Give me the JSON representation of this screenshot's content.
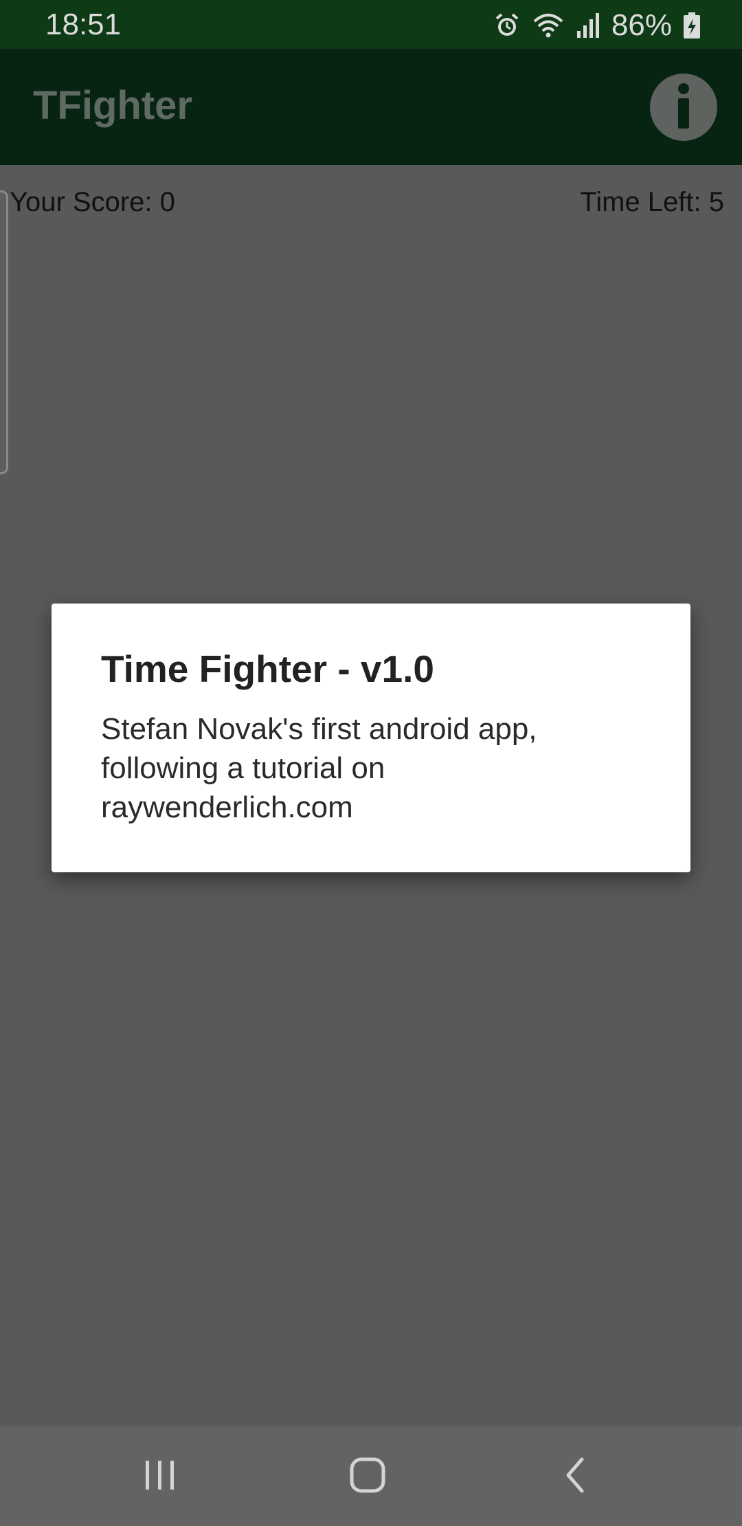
{
  "status_bar": {
    "time": "18:51",
    "battery_percent": "86%",
    "icons": [
      "alarm-icon",
      "wifi-icon",
      "signal-icon",
      "battery-charging-icon"
    ]
  },
  "app_bar": {
    "title": "TFighter",
    "info_icon": "info-icon"
  },
  "game": {
    "score_text": "Your Score: 0",
    "time_left_text": "Time Left: 5"
  },
  "dialog": {
    "title": "Time Fighter - v1.0",
    "message": "Stefan Novak's first android app, following a tutorial on raywenderlich.com"
  },
  "nav_bar": {
    "icons": [
      "recents-icon",
      "home-icon",
      "back-icon"
    ]
  },
  "colors": {
    "status_bar": "#0e3a16",
    "app_bar": "#072413",
    "scrim_background": "#595959",
    "dialog_background": "#ffffff",
    "nav_bar": "#636363"
  }
}
